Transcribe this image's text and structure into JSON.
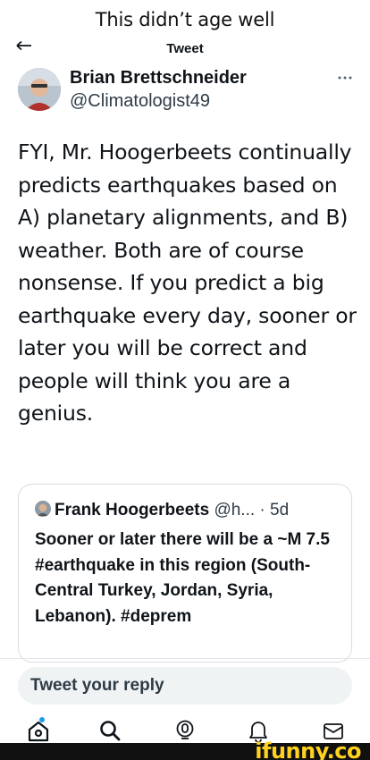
{
  "caption": "This didn’t age well",
  "header": {
    "title": "Tweet",
    "back_icon": "arrow-left-icon"
  },
  "tweet": {
    "author_name": "Brian Brettschneider",
    "author_handle": "@Climatologist49",
    "more_icon": "more-horizontal-icon",
    "text": "FYI, Mr. Hoogerbeets continually predicts earthquakes based on A) planetary alignments, and B) weather. Both are of course nonsense. If you predict a big earthquake every day, sooner or later you will be correct and people will think you are a genius."
  },
  "quoted_tweet": {
    "author_name": "Frank Hoogerbeets",
    "author_handle": "@h...",
    "age": "· 5d",
    "text": "Sooner or later there will be a ~M 7.5 #earthquake in this region (South-Central Turkey, Jordan, Syria, Lebanon). #deprem"
  },
  "reply": {
    "placeholder": "Tweet your reply"
  },
  "bottom_nav": {
    "items": [
      "home-icon",
      "search-icon",
      "spaces-icon",
      "notifications-icon",
      "messages-icon"
    ],
    "active": "home-icon",
    "indicator_color": "#1d9bf0"
  },
  "watermark": "ifunny.co",
  "colors": {
    "text": "#0f1419",
    "secondary": "#2f3b46",
    "reply_bg": "#eff3f4",
    "watermark": "#ffd21f"
  }
}
